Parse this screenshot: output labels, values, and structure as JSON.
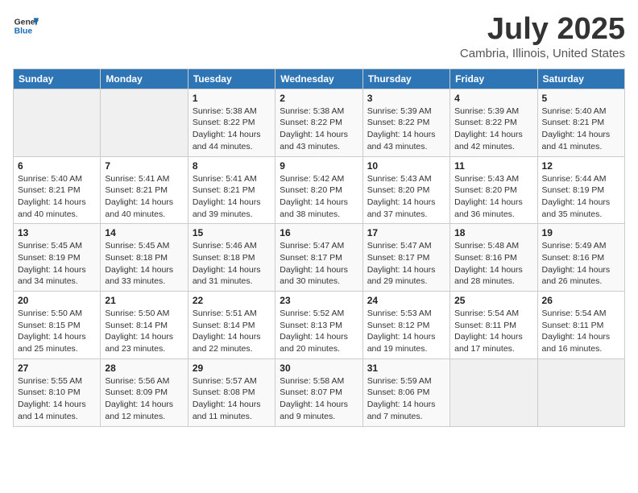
{
  "header": {
    "logo_line1": "General",
    "logo_line2": "Blue",
    "title": "July 2025",
    "subtitle": "Cambria, Illinois, United States"
  },
  "days_of_week": [
    "Sunday",
    "Monday",
    "Tuesday",
    "Wednesday",
    "Thursday",
    "Friday",
    "Saturday"
  ],
  "weeks": [
    [
      {
        "day": "",
        "info": ""
      },
      {
        "day": "",
        "info": ""
      },
      {
        "day": "1",
        "info": "Sunrise: 5:38 AM\nSunset: 8:22 PM\nDaylight: 14 hours and 44 minutes."
      },
      {
        "day": "2",
        "info": "Sunrise: 5:38 AM\nSunset: 8:22 PM\nDaylight: 14 hours and 43 minutes."
      },
      {
        "day": "3",
        "info": "Sunrise: 5:39 AM\nSunset: 8:22 PM\nDaylight: 14 hours and 43 minutes."
      },
      {
        "day": "4",
        "info": "Sunrise: 5:39 AM\nSunset: 8:22 PM\nDaylight: 14 hours and 42 minutes."
      },
      {
        "day": "5",
        "info": "Sunrise: 5:40 AM\nSunset: 8:21 PM\nDaylight: 14 hours and 41 minutes."
      }
    ],
    [
      {
        "day": "6",
        "info": "Sunrise: 5:40 AM\nSunset: 8:21 PM\nDaylight: 14 hours and 40 minutes."
      },
      {
        "day": "7",
        "info": "Sunrise: 5:41 AM\nSunset: 8:21 PM\nDaylight: 14 hours and 40 minutes."
      },
      {
        "day": "8",
        "info": "Sunrise: 5:41 AM\nSunset: 8:21 PM\nDaylight: 14 hours and 39 minutes."
      },
      {
        "day": "9",
        "info": "Sunrise: 5:42 AM\nSunset: 8:20 PM\nDaylight: 14 hours and 38 minutes."
      },
      {
        "day": "10",
        "info": "Sunrise: 5:43 AM\nSunset: 8:20 PM\nDaylight: 14 hours and 37 minutes."
      },
      {
        "day": "11",
        "info": "Sunrise: 5:43 AM\nSunset: 8:20 PM\nDaylight: 14 hours and 36 minutes."
      },
      {
        "day": "12",
        "info": "Sunrise: 5:44 AM\nSunset: 8:19 PM\nDaylight: 14 hours and 35 minutes."
      }
    ],
    [
      {
        "day": "13",
        "info": "Sunrise: 5:45 AM\nSunset: 8:19 PM\nDaylight: 14 hours and 34 minutes."
      },
      {
        "day": "14",
        "info": "Sunrise: 5:45 AM\nSunset: 8:18 PM\nDaylight: 14 hours and 33 minutes."
      },
      {
        "day": "15",
        "info": "Sunrise: 5:46 AM\nSunset: 8:18 PM\nDaylight: 14 hours and 31 minutes."
      },
      {
        "day": "16",
        "info": "Sunrise: 5:47 AM\nSunset: 8:17 PM\nDaylight: 14 hours and 30 minutes."
      },
      {
        "day": "17",
        "info": "Sunrise: 5:47 AM\nSunset: 8:17 PM\nDaylight: 14 hours and 29 minutes."
      },
      {
        "day": "18",
        "info": "Sunrise: 5:48 AM\nSunset: 8:16 PM\nDaylight: 14 hours and 28 minutes."
      },
      {
        "day": "19",
        "info": "Sunrise: 5:49 AM\nSunset: 8:16 PM\nDaylight: 14 hours and 26 minutes."
      }
    ],
    [
      {
        "day": "20",
        "info": "Sunrise: 5:50 AM\nSunset: 8:15 PM\nDaylight: 14 hours and 25 minutes."
      },
      {
        "day": "21",
        "info": "Sunrise: 5:50 AM\nSunset: 8:14 PM\nDaylight: 14 hours and 23 minutes."
      },
      {
        "day": "22",
        "info": "Sunrise: 5:51 AM\nSunset: 8:14 PM\nDaylight: 14 hours and 22 minutes."
      },
      {
        "day": "23",
        "info": "Sunrise: 5:52 AM\nSunset: 8:13 PM\nDaylight: 14 hours and 20 minutes."
      },
      {
        "day": "24",
        "info": "Sunrise: 5:53 AM\nSunset: 8:12 PM\nDaylight: 14 hours and 19 minutes."
      },
      {
        "day": "25",
        "info": "Sunrise: 5:54 AM\nSunset: 8:11 PM\nDaylight: 14 hours and 17 minutes."
      },
      {
        "day": "26",
        "info": "Sunrise: 5:54 AM\nSunset: 8:11 PM\nDaylight: 14 hours and 16 minutes."
      }
    ],
    [
      {
        "day": "27",
        "info": "Sunrise: 5:55 AM\nSunset: 8:10 PM\nDaylight: 14 hours and 14 minutes."
      },
      {
        "day": "28",
        "info": "Sunrise: 5:56 AM\nSunset: 8:09 PM\nDaylight: 14 hours and 12 minutes."
      },
      {
        "day": "29",
        "info": "Sunrise: 5:57 AM\nSunset: 8:08 PM\nDaylight: 14 hours and 11 minutes."
      },
      {
        "day": "30",
        "info": "Sunrise: 5:58 AM\nSunset: 8:07 PM\nDaylight: 14 hours and 9 minutes."
      },
      {
        "day": "31",
        "info": "Sunrise: 5:59 AM\nSunset: 8:06 PM\nDaylight: 14 hours and 7 minutes."
      },
      {
        "day": "",
        "info": ""
      },
      {
        "day": "",
        "info": ""
      }
    ]
  ]
}
